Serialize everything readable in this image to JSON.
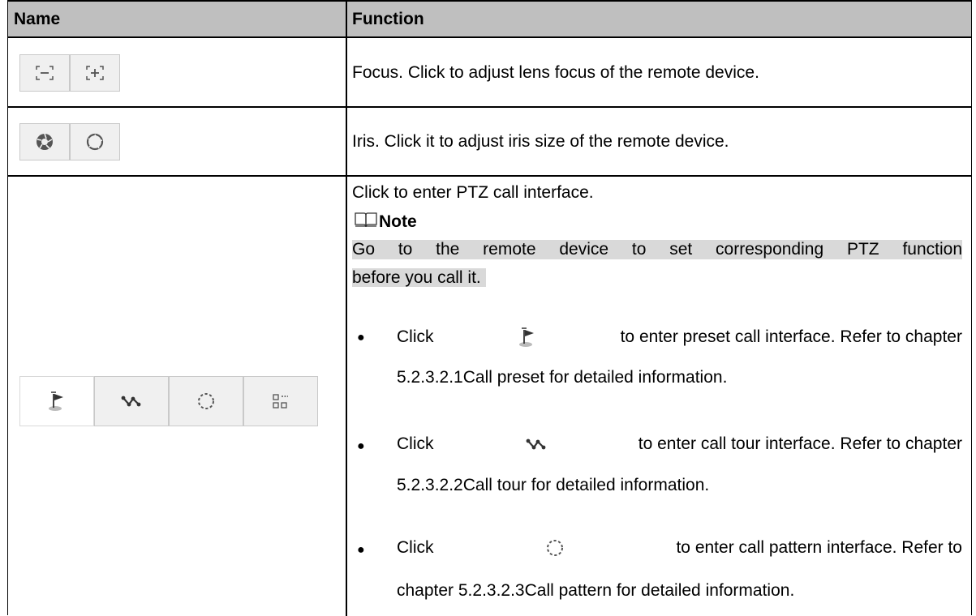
{
  "table": {
    "headers": {
      "name": "Name",
      "function": "Function"
    },
    "rows": [
      {
        "icons": [
          "focus-minus-icon",
          "focus-plus-icon"
        ],
        "function": "Focus. Click to adjust lens focus of the remote device."
      },
      {
        "icons": [
          "iris-open-icon",
          "iris-close-icon"
        ],
        "function": "Iris. Click it to adjust iris size of the remote device."
      },
      {
        "icons": [
          "preset-flag-icon",
          "tour-icon",
          "pattern-icon",
          "more-icon"
        ],
        "intro": "Click to enter PTZ call interface.",
        "note_label": "Note",
        "note_line1": "Go to the remote device to set corresponding PTZ function",
        "note_line2": "before you call it.",
        "bullets": [
          {
            "click": "Click",
            "icon": "preset-flag-icon",
            "line1_rest": "to enter preset call interface. Refer to chapter",
            "line2": "5.2.3.2.1Call preset for detailed information."
          },
          {
            "click": "Click",
            "icon": "tour-icon",
            "line1_rest": "to enter call tour interface. Refer to chapter",
            "line2": "5.2.3.2.2Call tour for detailed information."
          },
          {
            "click": "Click",
            "icon": "pattern-icon",
            "line1_rest": "to enter call pattern interface. Refer to",
            "line2": "chapter 5.2.3.2.3Call pattern for detailed information."
          }
        ]
      }
    ]
  }
}
